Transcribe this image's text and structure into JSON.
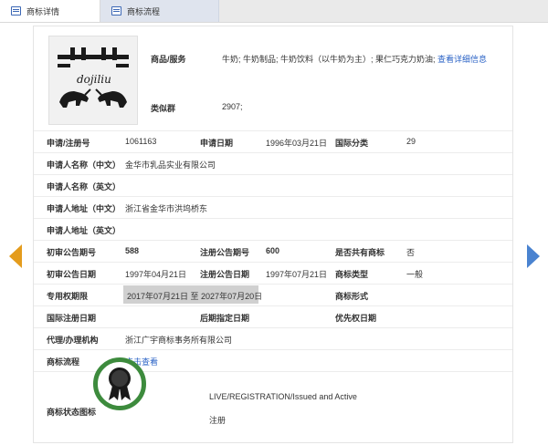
{
  "tabs": [
    {
      "label": "商标详情"
    },
    {
      "label": "商标流程"
    }
  ],
  "colors": {
    "accent": "#2b63c6",
    "left_arrow": "#e49c1d",
    "right_arrow": "#4a83d0",
    "status_ring": "#3d8b3d"
  },
  "logo": {
    "wordmark": "dojiliu"
  },
  "goods": {
    "label": "商品/服务",
    "value": "牛奶; 牛奶制品; 牛奶饮料（以牛奶为主）; 果仁巧克力奶油;",
    "link": "查看详细信息"
  },
  "similar_group": {
    "label": "类似群",
    "value": "2907;"
  },
  "application": {
    "reg_no_label": "申请/注册号",
    "reg_no": "1061163",
    "date_label": "申请日期",
    "date": "1996年03月21日",
    "class_label": "国际分类",
    "class": "29"
  },
  "applicant": {
    "name_cn_label": "申请人名称（中文）",
    "name_cn": "金华市乳品实业有限公司",
    "name_en_label": "申请人名称（英文）",
    "name_en": "",
    "addr_cn_label": "申请人地址（中文）",
    "addr_cn": "浙江省金华市洪坞桥东",
    "addr_en_label": "申请人地址（英文）",
    "addr_en": ""
  },
  "publication": {
    "prelim_no_label": "初审公告期号",
    "prelim_no": "588",
    "reg_no_label": "注册公告期号",
    "reg_no": "600",
    "shared_label": "是否共有商标",
    "shared": "否",
    "prelim_date_label": "初审公告日期",
    "prelim_date": "1997年04月21日",
    "reg_date_label": "注册公告日期",
    "reg_date": "1997年07月21日",
    "type_label": "商标类型",
    "type": "一般"
  },
  "rights": {
    "period_label": "专用权期限",
    "period": "2017年07月21日 至 2027年07月20日",
    "form_label": "商标形式",
    "form": ""
  },
  "intl": {
    "intl_date_label": "国际注册日期",
    "intl_date": "",
    "late_date_label": "后期指定日期",
    "late_date": "",
    "priority_label": "优先权日期",
    "priority": ""
  },
  "agent": {
    "label": "代理/办理机构",
    "value": "浙江广宇商标事务所有限公司"
  },
  "process": {
    "label": "商标流程",
    "link": "点击查看"
  },
  "status": {
    "label": "商标状态图标",
    "en": "LIVE/REGISTRATION/Issued and Active",
    "cn": "注册"
  }
}
